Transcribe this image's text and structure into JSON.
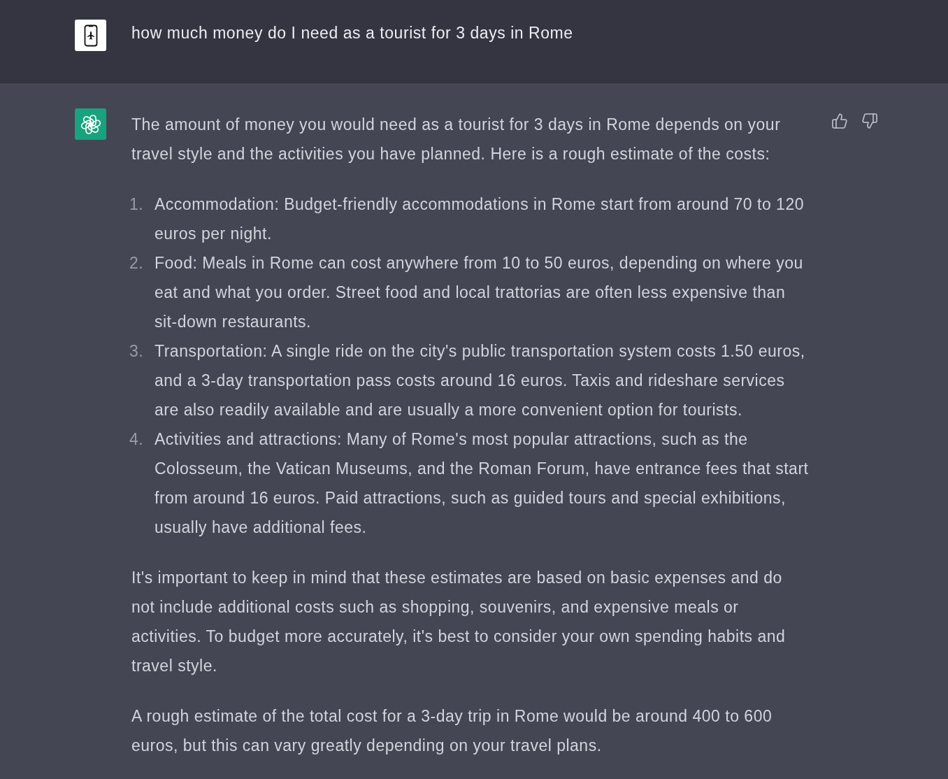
{
  "user_message": {
    "text": "how much money do I need as a tourist for 3 days in Rome"
  },
  "assistant_message": {
    "intro": "The amount of money you would need as a tourist for 3 days in Rome depends on your travel style and the activities you have planned. Here is a rough estimate of the costs:",
    "list": [
      {
        "marker": "1.",
        "text": "Accommodation: Budget-friendly accommodations in Rome start from around 70 to 120 euros per night."
      },
      {
        "marker": "2.",
        "text": "Food: Meals in Rome can cost anywhere from 10 to 50 euros, depending on where you eat and what you order. Street food and local trattorias are often less expensive than sit-down restaurants."
      },
      {
        "marker": "3.",
        "text": "Transportation: A single ride on the city's public transportation system costs 1.50 euros, and a 3-day transportation pass costs around 16 euros. Taxis and rideshare services are also readily available and are usually a more convenient option for tourists."
      },
      {
        "marker": "4.",
        "text": "Activities and attractions: Many of Rome's most popular attractions, such as the Colosseum, the Vatican Museums, and the Roman Forum, have entrance fees that start from around 16 euros. Paid attractions, such as guided tours and special exhibitions, usually have additional fees."
      }
    ],
    "paragraphs": [
      "It's important to keep in mind that these estimates are based on basic expenses and do not include additional costs such as shopping, souvenirs, and expensive meals or activities. To budget more accurately, it's best to consider your own spending habits and travel style.",
      "A rough estimate of the total cost for a 3-day trip in Rome would be around 400 to 600 euros, but this can vary greatly depending on your travel plans."
    ]
  }
}
